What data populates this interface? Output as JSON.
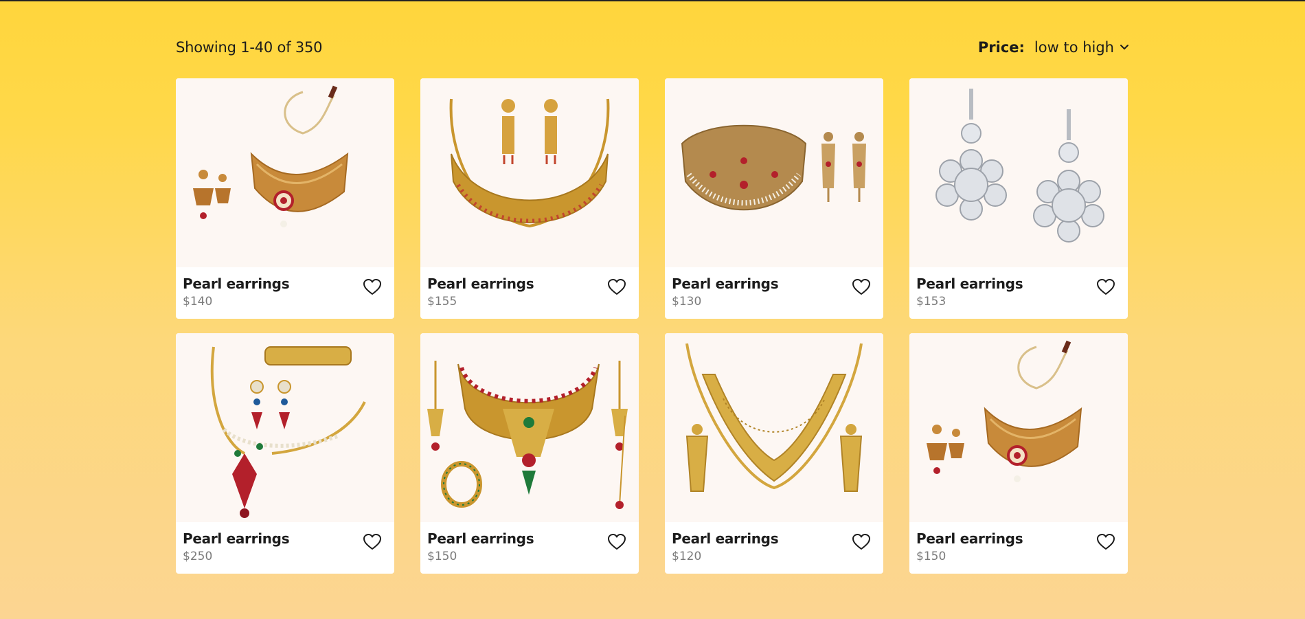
{
  "results": {
    "showing_text": "Showing 1-40 of 350"
  },
  "sort": {
    "label": "Price:",
    "value": "low to high",
    "icon": "chevron-down-icon"
  },
  "products": [
    {
      "name": "Pearl earrings",
      "price": "$140",
      "image": "gold-choker-set",
      "icon": "heart-icon"
    },
    {
      "name": "Pearl earrings",
      "price": "$155",
      "image": "gold-necklace-set",
      "icon": "heart-icon"
    },
    {
      "name": "Pearl earrings",
      "price": "$130",
      "image": "kundan-choker-set",
      "icon": "heart-icon"
    },
    {
      "name": "Pearl earrings",
      "price": "$153",
      "image": "diamond-earrings",
      "icon": "heart-icon"
    },
    {
      "name": "Pearl earrings",
      "price": "$250",
      "image": "ruby-necklace-set",
      "icon": "heart-icon"
    },
    {
      "name": "Pearl earrings",
      "price": "$150",
      "image": "bridal-jewelry-set",
      "icon": "heart-icon"
    },
    {
      "name": "Pearl earrings",
      "price": "$120",
      "image": "gold-filigree-set",
      "icon": "heart-icon"
    },
    {
      "name": "Pearl earrings",
      "price": "$150",
      "image": "gold-choker-set",
      "icon": "heart-icon"
    }
  ],
  "colors": {
    "background_top": "#ffd63c",
    "background_bottom": "#fcd592",
    "card": "#ffffff",
    "image_bg": "#fdf7f3",
    "gold": "#c9962e",
    "ruby": "#b3202b",
    "emerald": "#1f7a3a",
    "silver": "#c8ccd2",
    "price_text": "#7b7b7b"
  }
}
